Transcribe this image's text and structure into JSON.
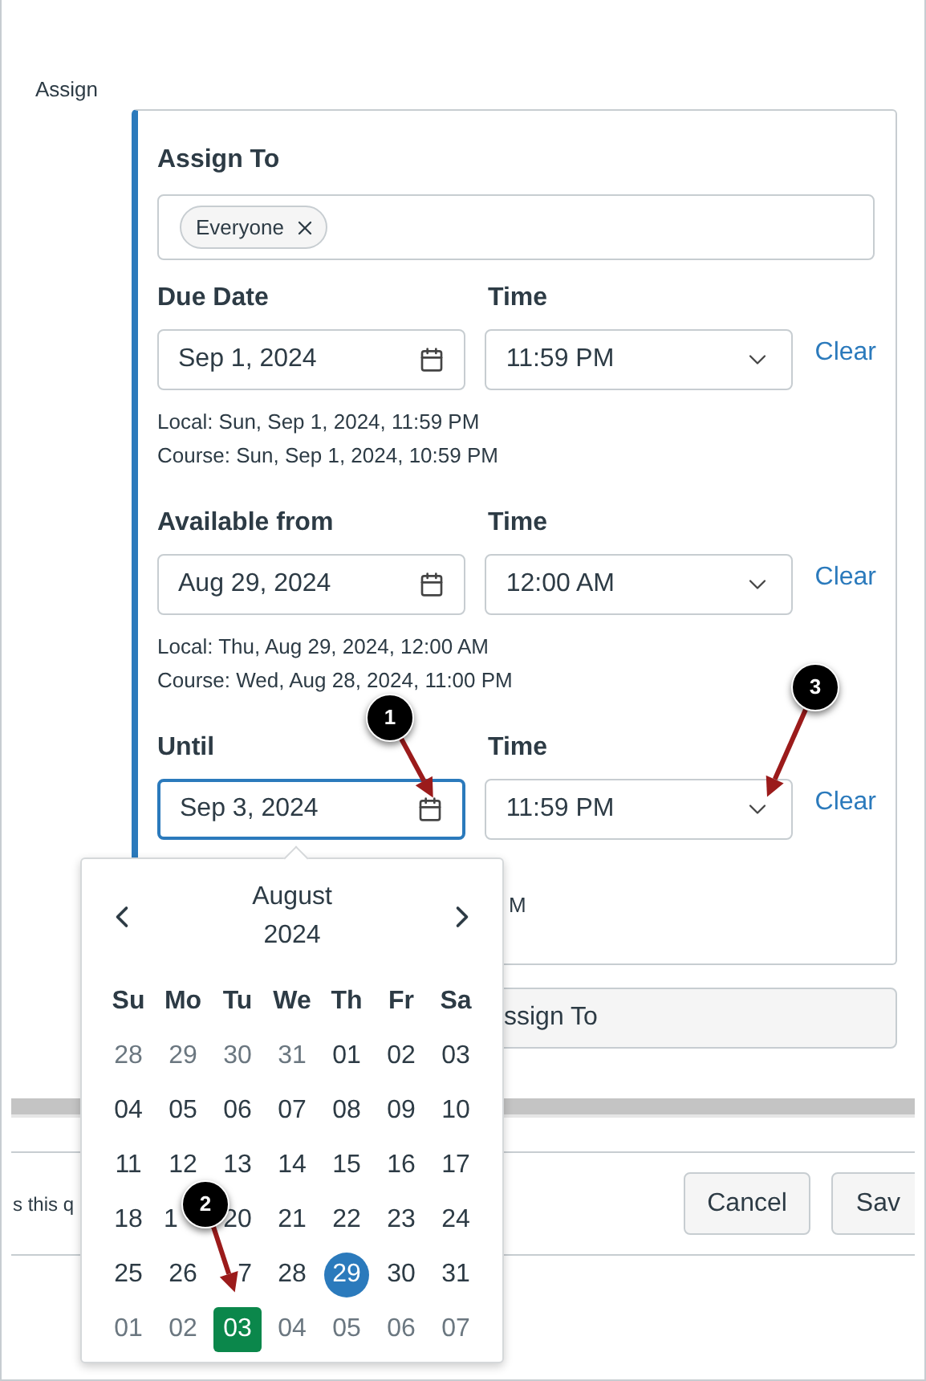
{
  "section_label": "Assign",
  "assign_to": {
    "label": "Assign To",
    "tags": [
      {
        "label": "Everyone"
      }
    ]
  },
  "date_groups": [
    {
      "date_label": "Due Date",
      "time_label": "Time",
      "date": "Sep 1, 2024",
      "time": "11:59 PM",
      "focused": false,
      "clear": "Clear",
      "local": "Local: Sun, Sep 1, 2024, 11:59 PM",
      "course": "Course: Sun, Sep 1, 2024, 10:59 PM"
    },
    {
      "date_label": "Available from",
      "time_label": "Time",
      "date": "Aug 29, 2024",
      "time": "12:00 AM",
      "focused": false,
      "clear": "Clear",
      "local": "Local: Thu, Aug 29, 2024, 12:00 AM",
      "course": "Course: Wed, Aug 28, 2024, 11:00 PM"
    },
    {
      "date_label": "Until",
      "time_label": "Time",
      "date": "Sep 3, 2024",
      "time": "11:59 PM",
      "focused": true,
      "clear": "Clear",
      "course": "M"
    }
  ],
  "assign_to_button": "ssign To",
  "footer": {
    "text": "s this q",
    "buttons": [
      {
        "label": "Cancel"
      },
      {
        "label": "Sav"
      }
    ]
  },
  "calendar": {
    "month": "August",
    "year": "2024",
    "weekdays": [
      "Su",
      "Mo",
      "Tu",
      "We",
      "Th",
      "Fr",
      "Sa"
    ],
    "days": [
      {
        "label": "28",
        "outside": true,
        "today": false,
        "selected": false
      },
      {
        "label": "29",
        "outside": true,
        "today": false,
        "selected": false
      },
      {
        "label": "30",
        "outside": true,
        "today": false,
        "selected": false
      },
      {
        "label": "31",
        "outside": true,
        "today": false,
        "selected": false
      },
      {
        "label": "01",
        "outside": false,
        "today": false,
        "selected": false
      },
      {
        "label": "02",
        "outside": false,
        "today": false,
        "selected": false
      },
      {
        "label": "03",
        "outside": false,
        "today": false,
        "selected": false
      },
      {
        "label": "04",
        "outside": false,
        "today": false,
        "selected": false
      },
      {
        "label": "05",
        "outside": false,
        "today": false,
        "selected": false
      },
      {
        "label": "06",
        "outside": false,
        "today": false,
        "selected": false
      },
      {
        "label": "07",
        "outside": false,
        "today": false,
        "selected": false
      },
      {
        "label": "08",
        "outside": false,
        "today": false,
        "selected": false
      },
      {
        "label": "09",
        "outside": false,
        "today": false,
        "selected": false
      },
      {
        "label": "10",
        "outside": false,
        "today": false,
        "selected": false
      },
      {
        "label": "11",
        "outside": false,
        "today": false,
        "selected": false
      },
      {
        "label": "12",
        "outside": false,
        "today": false,
        "selected": false
      },
      {
        "label": "13",
        "outside": false,
        "today": false,
        "selected": false
      },
      {
        "label": "14",
        "outside": false,
        "today": false,
        "selected": false
      },
      {
        "label": "15",
        "outside": false,
        "today": false,
        "selected": false
      },
      {
        "label": "16",
        "outside": false,
        "today": false,
        "selected": false
      },
      {
        "label": "17",
        "outside": false,
        "today": false,
        "selected": false
      },
      {
        "label": "18",
        "outside": false,
        "today": false,
        "selected": false
      },
      {
        "label": "1",
        "right_hidden": true,
        "outside": false,
        "today": false,
        "selected": false
      },
      {
        "label": "20",
        "outside": false,
        "today": false,
        "selected": false
      },
      {
        "label": "21",
        "outside": false,
        "today": false,
        "selected": false
      },
      {
        "label": "22",
        "outside": false,
        "today": false,
        "selected": false
      },
      {
        "label": "23",
        "outside": false,
        "today": false,
        "selected": false
      },
      {
        "label": "24",
        "outside": false,
        "today": false,
        "selected": false
      },
      {
        "label": "25",
        "outside": false,
        "today": false,
        "selected": false
      },
      {
        "label": "26",
        "outside": false,
        "today": false,
        "selected": false
      },
      {
        "label": "7",
        "left_hidden": true,
        "outside": false,
        "today": false,
        "selected": false
      },
      {
        "label": "28",
        "outside": false,
        "today": false,
        "selected": false
      },
      {
        "label": "29",
        "outside": false,
        "today": true,
        "selected": false
      },
      {
        "label": "30",
        "outside": false,
        "today": false,
        "selected": false
      },
      {
        "label": "31",
        "outside": false,
        "today": false,
        "selected": false
      },
      {
        "label": "01",
        "outside": true,
        "today": false,
        "selected": false
      },
      {
        "label": "02",
        "outside": true,
        "today": false,
        "selected": false
      },
      {
        "label": "03",
        "outside": true,
        "today": false,
        "selected": true
      },
      {
        "label": "04",
        "outside": true,
        "today": false,
        "selected": false
      },
      {
        "label": "05",
        "outside": true,
        "today": false,
        "selected": false
      },
      {
        "label": "06",
        "outside": true,
        "today": false,
        "selected": false
      },
      {
        "label": "07",
        "outside": true,
        "today": false,
        "selected": false
      }
    ]
  },
  "callouts": [
    {
      "label": "1"
    },
    {
      "label": "2"
    },
    {
      "label": "3"
    }
  ]
}
